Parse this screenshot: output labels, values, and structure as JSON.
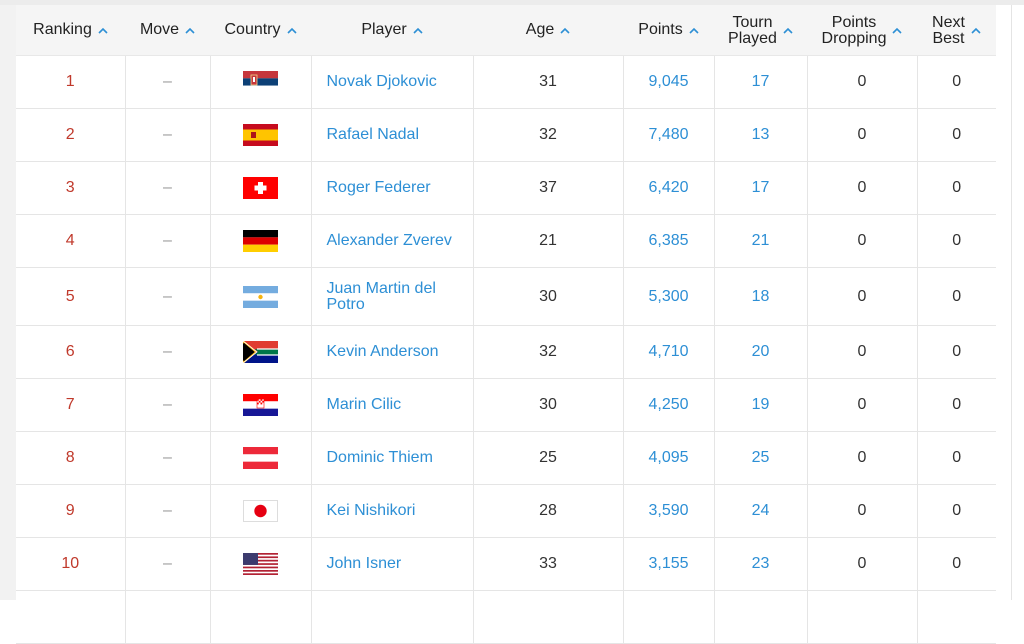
{
  "columns": [
    {
      "key": "ranking",
      "label": "Ranking"
    },
    {
      "key": "move",
      "label": "Move"
    },
    {
      "key": "country",
      "label": "Country"
    },
    {
      "key": "player",
      "label": "Player"
    },
    {
      "key": "age",
      "label": "Age"
    },
    {
      "key": "points",
      "label": "Points"
    },
    {
      "key": "tourn_played",
      "label_line1": "Tourn",
      "label_line2": "Played"
    },
    {
      "key": "points_dropping",
      "label_line1": "Points",
      "label_line2": "Dropping"
    },
    {
      "key": "next_best",
      "label_line1": "Next",
      "label_line2": "Best"
    }
  ],
  "sort_icon": "chevron-up-icon",
  "colors": {
    "rank": "#c0392b",
    "link": "#2d8fd5",
    "header_bg": "#f5f5f5",
    "sort_icon": "#2d8fd5"
  },
  "rows": [
    {
      "rank": "1",
      "move": "–",
      "country": "serbia",
      "player": "Novak Djokovic",
      "age": "31",
      "points": "9,045",
      "tourn": "17",
      "dropping": "0",
      "next": "0"
    },
    {
      "rank": "2",
      "move": "–",
      "country": "spain",
      "player": "Rafael Nadal",
      "age": "32",
      "points": "7,480",
      "tourn": "13",
      "dropping": "0",
      "next": "0"
    },
    {
      "rank": "3",
      "move": "–",
      "country": "switzerland",
      "player": "Roger Federer",
      "age": "37",
      "points": "6,420",
      "tourn": "17",
      "dropping": "0",
      "next": "0"
    },
    {
      "rank": "4",
      "move": "–",
      "country": "germany",
      "player": "Alexander Zverev",
      "age": "21",
      "points": "6,385",
      "tourn": "21",
      "dropping": "0",
      "next": "0"
    },
    {
      "rank": "5",
      "move": "–",
      "country": "argentina",
      "player_line1": "Juan Martin del",
      "player_line2": "Potro",
      "age": "30",
      "points": "5,300",
      "tourn": "18",
      "dropping": "0",
      "next": "0"
    },
    {
      "rank": "6",
      "move": "–",
      "country": "south-africa",
      "player": "Kevin Anderson",
      "age": "32",
      "points": "4,710",
      "tourn": "20",
      "dropping": "0",
      "next": "0"
    },
    {
      "rank": "7",
      "move": "–",
      "country": "croatia",
      "player": "Marin Cilic",
      "age": "30",
      "points": "4,250",
      "tourn": "19",
      "dropping": "0",
      "next": "0"
    },
    {
      "rank": "8",
      "move": "–",
      "country": "austria",
      "player": "Dominic Thiem",
      "age": "25",
      "points": "4,095",
      "tourn": "25",
      "dropping": "0",
      "next": "0"
    },
    {
      "rank": "9",
      "move": "–",
      "country": "japan",
      "player": "Kei Nishikori",
      "age": "28",
      "points": "3,590",
      "tourn": "24",
      "dropping": "0",
      "next": "0"
    },
    {
      "rank": "10",
      "move": "–",
      "country": "usa",
      "player": "John Isner",
      "age": "33",
      "points": "3,155",
      "tourn": "23",
      "dropping": "0",
      "next": "0"
    }
  ]
}
